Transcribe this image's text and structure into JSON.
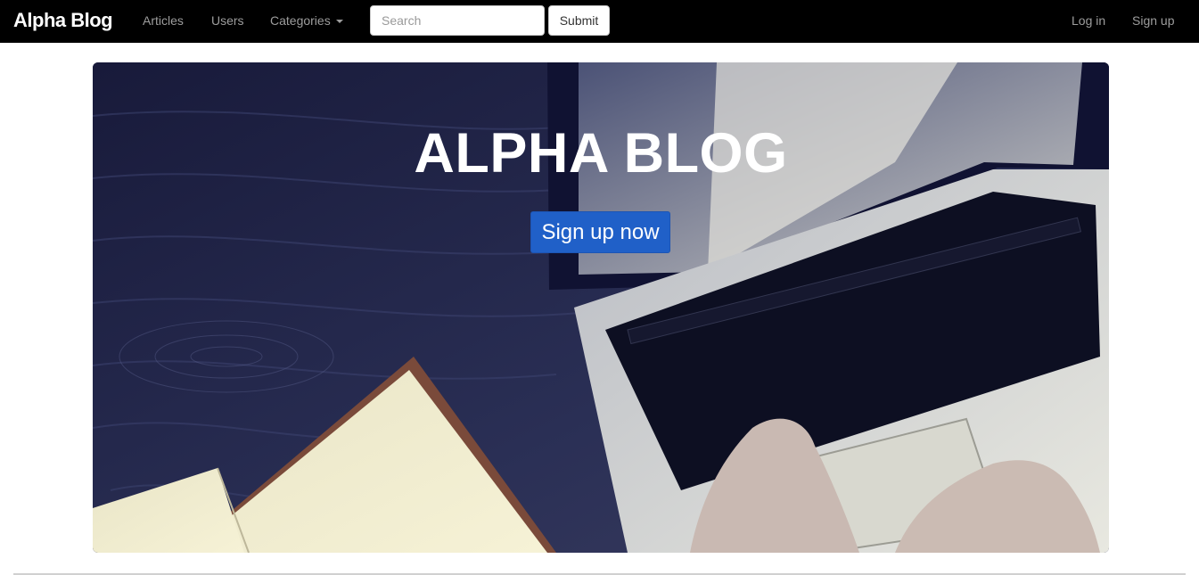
{
  "navbar": {
    "brand": "Alpha Blog",
    "links": {
      "articles": "Articles",
      "users": "Users",
      "categories": "Categories"
    },
    "search": {
      "placeholder": "Search",
      "value": ""
    },
    "submit_label": "Submit",
    "right": {
      "login": "Log in",
      "signup": "Sign up"
    }
  },
  "hero": {
    "title": "ALPHA BLOG",
    "cta_label": "Sign up now"
  },
  "colors": {
    "navbar_bg": "#000000",
    "nav_link": "#9d9d9d",
    "cta_bg": "#2060c8"
  },
  "icons": {
    "categories_caret": "caret-down-icon"
  }
}
